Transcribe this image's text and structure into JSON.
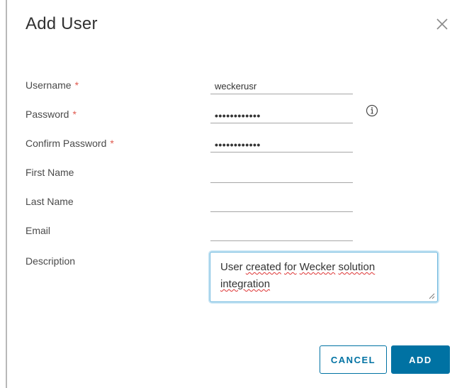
{
  "dialog": {
    "title": "Add User"
  },
  "form": {
    "username": {
      "label": "Username",
      "required_mark": "*",
      "value": "weckerusr"
    },
    "password": {
      "label": "Password",
      "required_mark": "*",
      "value": "••••••••••••"
    },
    "confirm_password": {
      "label": "Confirm Password",
      "required_mark": "*",
      "value": "••••••••••••"
    },
    "first_name": {
      "label": "First Name",
      "value": ""
    },
    "last_name": {
      "label": "Last Name",
      "value": ""
    },
    "email": {
      "label": "Email",
      "value": ""
    },
    "description": {
      "label": "Description",
      "text_parts": [
        "User ",
        "created",
        " ",
        "for",
        " ",
        "Wecker",
        " ",
        "solution",
        " ",
        "integration"
      ]
    }
  },
  "buttons": {
    "cancel_label": "CANCEL",
    "add_label": "ADD"
  },
  "icons": {
    "close": "close-icon",
    "info": "info-icon",
    "resize": "resize-handle-icon"
  },
  "colors": {
    "accent": "#0072a3",
    "required": "#e05a4f",
    "focus_border": "#6fb8de",
    "spellcheck": "#dd3333"
  }
}
